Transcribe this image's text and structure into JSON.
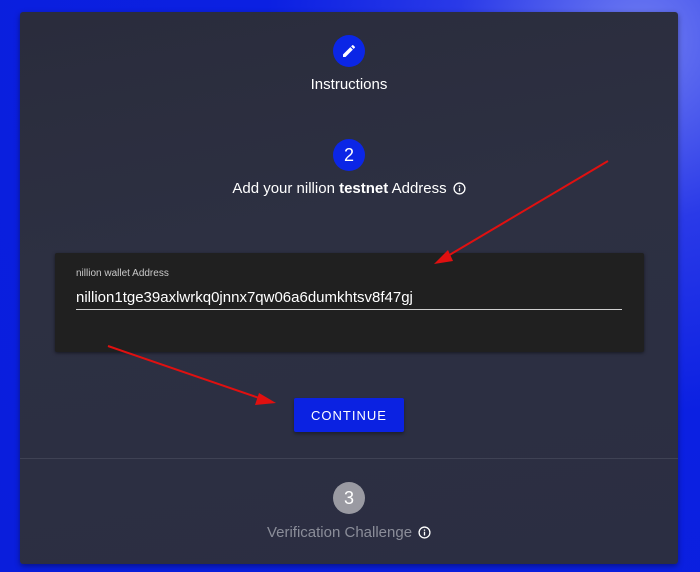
{
  "steps": [
    {
      "number": "",
      "label": "Instructions",
      "state": "completed",
      "icon": "pencil-icon"
    },
    {
      "number": "2",
      "label_prefix": "Add your nillion ",
      "label_bold": "testnet",
      "label_suffix": " Address",
      "state": "active",
      "icon": "info-icon"
    },
    {
      "number": "3",
      "label": "Verification Challenge",
      "state": "inactive",
      "icon": "info-icon"
    }
  ],
  "form": {
    "field_label": "nillion wallet Address",
    "field_value": "nillion1tge39axlwrkq0jnnx7qw06a6dumkhtsv8f47gj",
    "continue_label": "CONTINUE"
  },
  "colors": {
    "accent": "#0b26e6",
    "background": "#0a1edc",
    "card": "#2d3042",
    "panel": "#202020",
    "annotation_arrow": "#e01010"
  }
}
